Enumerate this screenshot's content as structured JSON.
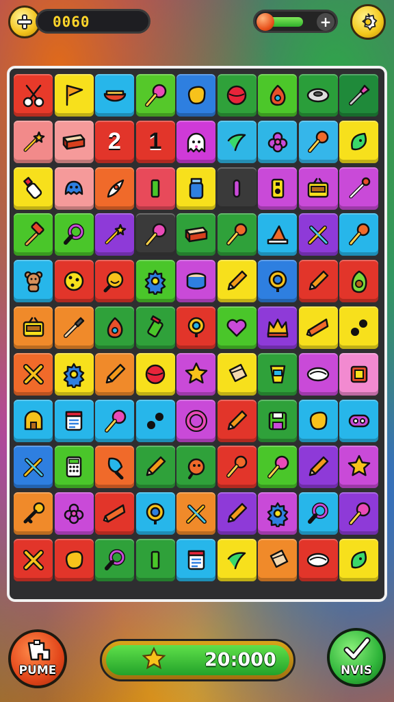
{
  "hud": {
    "score": "0060",
    "coin_icon": "plus-coin-icon",
    "settings_icon": "gear-icon",
    "energy_add_label": "+"
  },
  "board": {
    "tiles": [
      {
        "c": "#e83a2a",
        "i": "scissors"
      },
      {
        "c": "#f7e01c",
        "i": "flag"
      },
      {
        "c": "#27b6ea",
        "i": "bowl"
      },
      {
        "c": "#55c82a",
        "i": "lollipop"
      },
      {
        "c": "#2e7fe0",
        "i": "blob"
      },
      {
        "c": "#2fa13a",
        "i": "ball"
      },
      {
        "c": "#4cc72a",
        "i": "drop"
      },
      {
        "c": "#2a9e3a",
        "i": "tape"
      },
      {
        "c": "#1f8a3a",
        "i": "wrench"
      },
      {
        "c": "#f28a8a",
        "i": "wand"
      },
      {
        "c": "#f59a9a",
        "i": "book"
      },
      {
        "c": "#e2352a",
        "n": "2"
      },
      {
        "c": "#e2352a",
        "n": "1"
      },
      {
        "c": "#cf3ad8",
        "i": "ghost"
      },
      {
        "c": "#2fb6e6",
        "i": "check"
      },
      {
        "c": "#2fb6e6",
        "i": "flower"
      },
      {
        "c": "#35b6ea",
        "i": "mic"
      },
      {
        "c": "#f7e01c",
        "i": "leaf"
      },
      {
        "c": "#f7e01c",
        "i": "bottle"
      },
      {
        "c": "#f59a9a",
        "i": "monster"
      },
      {
        "c": "#f06a2a",
        "i": "rocket"
      },
      {
        "c": "#e84a5a",
        "i": "bar"
      },
      {
        "c": "#f7e01c",
        "i": "jar"
      },
      {
        "c": "#3a3a3a",
        "i": "stick"
      },
      {
        "c": "#c94ad8",
        "i": "speaker"
      },
      {
        "c": "#c94ad8",
        "i": "radio"
      },
      {
        "c": "#c94ad8",
        "i": "pipette"
      },
      {
        "c": "#4ac62a",
        "i": "hammer"
      },
      {
        "c": "#4ac62a",
        "i": "magnifier"
      },
      {
        "c": "#8e3ad8",
        "i": "wand"
      },
      {
        "c": "#3a3a3a",
        "i": "lollipop"
      },
      {
        "c": "#2fa13a",
        "i": "book"
      },
      {
        "c": "#2fa13a",
        "i": "mic"
      },
      {
        "c": "#27b6ea",
        "i": "hat"
      },
      {
        "c": "#8e3ad8",
        "i": "tools"
      },
      {
        "c": "#27b6ea",
        "i": "mic"
      },
      {
        "c": "#27b6ea",
        "i": "bear"
      },
      {
        "c": "#e2352a",
        "i": "cookie"
      },
      {
        "c": "#e2352a",
        "i": "smile"
      },
      {
        "c": "#4ac62a",
        "i": "gear"
      },
      {
        "c": "#c94ad8",
        "i": "tin"
      },
      {
        "c": "#f7e01c",
        "i": "pencil"
      },
      {
        "c": "#2e7fe0",
        "i": "target"
      },
      {
        "c": "#e2352a",
        "i": "pencil"
      },
      {
        "c": "#e2352a",
        "i": "avocado"
      },
      {
        "c": "#f08a2a",
        "i": "radio"
      },
      {
        "c": "#f08a2a",
        "i": "brush"
      },
      {
        "c": "#2fa13a",
        "i": "drop"
      },
      {
        "c": "#2fa13a",
        "i": "can"
      },
      {
        "c": "#e2352a",
        "i": "pin"
      },
      {
        "c": "#4ac62a",
        "i": "heart"
      },
      {
        "c": "#8e3ad8",
        "i": "crown"
      },
      {
        "c": "#f7e01c",
        "i": "cone"
      },
      {
        "c": "#f7e01c",
        "i": "dots"
      },
      {
        "c": "#f06a2a",
        "i": "x"
      },
      {
        "c": "#f7e01c",
        "i": "gear"
      },
      {
        "c": "#f08a2a",
        "i": "pencil"
      },
      {
        "c": "#f7e01c",
        "i": "ball"
      },
      {
        "c": "#c94ad8",
        "i": "star"
      },
      {
        "c": "#f7e01c",
        "i": "pouch"
      },
      {
        "c": "#2fa13a",
        "i": "cup"
      },
      {
        "c": "#c94ad8",
        "i": "shell"
      },
      {
        "c": "#f28ad0",
        "i": "box"
      },
      {
        "c": "#27b6ea",
        "i": "house"
      },
      {
        "c": "#27b6ea",
        "i": "doc"
      },
      {
        "c": "#27b6ea",
        "i": "lollipop"
      },
      {
        "c": "#27b6ea",
        "i": "dots"
      },
      {
        "c": "#c94ad8",
        "i": "ring"
      },
      {
        "c": "#e2352a",
        "i": "pencil"
      },
      {
        "c": "#2fa13a",
        "i": "floppy"
      },
      {
        "c": "#27b6ea",
        "i": "blob"
      },
      {
        "c": "#27b6ea",
        "i": "pill"
      },
      {
        "c": "#2e7fe0",
        "i": "tools"
      },
      {
        "c": "#4ac62a",
        "i": "calc"
      },
      {
        "c": "#f06a2a",
        "i": "paddle"
      },
      {
        "c": "#2fa13a",
        "i": "pencil"
      },
      {
        "c": "#2fa13a",
        "i": "chick"
      },
      {
        "c": "#e2352a",
        "i": "mic"
      },
      {
        "c": "#4ac62a",
        "i": "lollipop"
      },
      {
        "c": "#8e3ad8",
        "i": "pencil"
      },
      {
        "c": "#c94ad8",
        "i": "star"
      },
      {
        "c": "#f08a2a",
        "i": "key"
      },
      {
        "c": "#c94ad8",
        "i": "flower"
      },
      {
        "c": "#e2352a",
        "i": "cone"
      },
      {
        "c": "#27b6ea",
        "i": "target"
      },
      {
        "c": "#f08a2a",
        "i": "tools"
      },
      {
        "c": "#8e3ad8",
        "i": "pencil"
      },
      {
        "c": "#c94ad8",
        "i": "gear"
      },
      {
        "c": "#27b6ea",
        "i": "magnifier"
      },
      {
        "c": "#8e3ad8",
        "i": "lollipop"
      },
      {
        "c": "#e2352a",
        "i": "x"
      },
      {
        "c": "#e2352a",
        "i": "blob"
      },
      {
        "c": "#2fa13a",
        "i": "magnifier"
      },
      {
        "c": "#2fa13a",
        "i": "bar"
      },
      {
        "c": "#27b6ea",
        "i": "doc"
      },
      {
        "c": "#f7e01c",
        "i": "check"
      },
      {
        "c": "#f08a2a",
        "i": "pouch"
      },
      {
        "c": "#e2352a",
        "i": "shell"
      },
      {
        "c": "#f7e01c",
        "i": "leaf"
      }
    ]
  },
  "footer": {
    "left_button_label": "PUME",
    "score_value": "20:000",
    "right_button_label": "NVIS"
  },
  "colors": {
    "outline": "#111111",
    "accent_gold": "#f3c21b",
    "accent_green": "#2fb53a"
  }
}
